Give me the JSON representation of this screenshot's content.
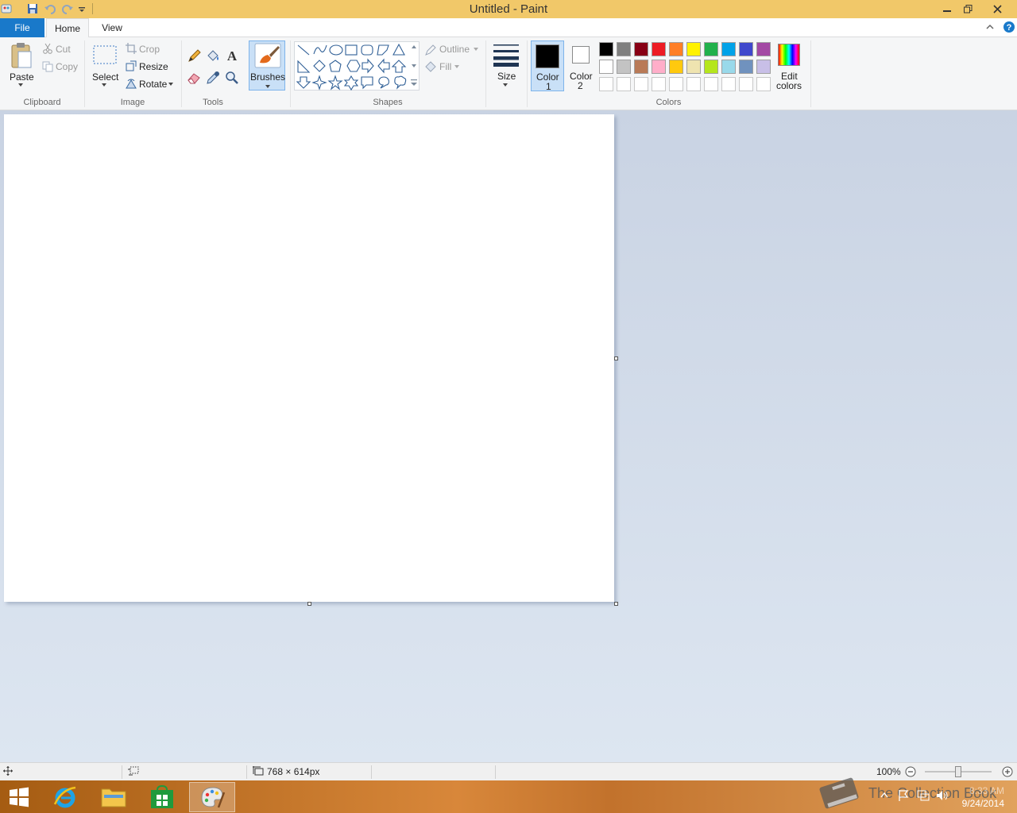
{
  "window": {
    "title": "Untitled - Paint"
  },
  "tabs": {
    "file": "File",
    "home": "Home",
    "view": "View"
  },
  "clipboard": {
    "paste": "Paste",
    "cut": "Cut",
    "copy": "Copy",
    "group": "Clipboard"
  },
  "image": {
    "select": "Select",
    "crop": "Crop",
    "resize": "Resize",
    "rotate": "Rotate",
    "group": "Image"
  },
  "tools": {
    "group": "Tools"
  },
  "brushes": {
    "label": "Brushes"
  },
  "shapes": {
    "outline": "Outline",
    "fill": "Fill",
    "group": "Shapes"
  },
  "size": {
    "label": "Size"
  },
  "colors": {
    "color1_line1": "Color",
    "color1_line2": "1",
    "color2_line1": "Color",
    "color2_line2": "2",
    "edit_line1": "Edit",
    "edit_line2": "colors",
    "group": "Colors",
    "color1_value": "#000000",
    "color2_value": "#ffffff",
    "palette_row1": [
      "#000000",
      "#7f7f7f",
      "#880015",
      "#ed1c24",
      "#ff7f27",
      "#fff200",
      "#22b14c",
      "#00a2e8",
      "#3f48cc",
      "#a349a4"
    ],
    "palette_row2": [
      "#ffffff",
      "#c3c3c3",
      "#b97a57",
      "#ffaec9",
      "#ffc90e",
      "#efe4b0",
      "#b5e61d",
      "#99d9ea",
      "#7092be",
      "#c8bfe7"
    ]
  },
  "status": {
    "dimensions": "768 × 614px",
    "zoom": "100%",
    "zoom_value": 100
  },
  "tray": {
    "watermark": "The Collection Book",
    "time": "8:33 AM",
    "date": "9/24/2014"
  }
}
